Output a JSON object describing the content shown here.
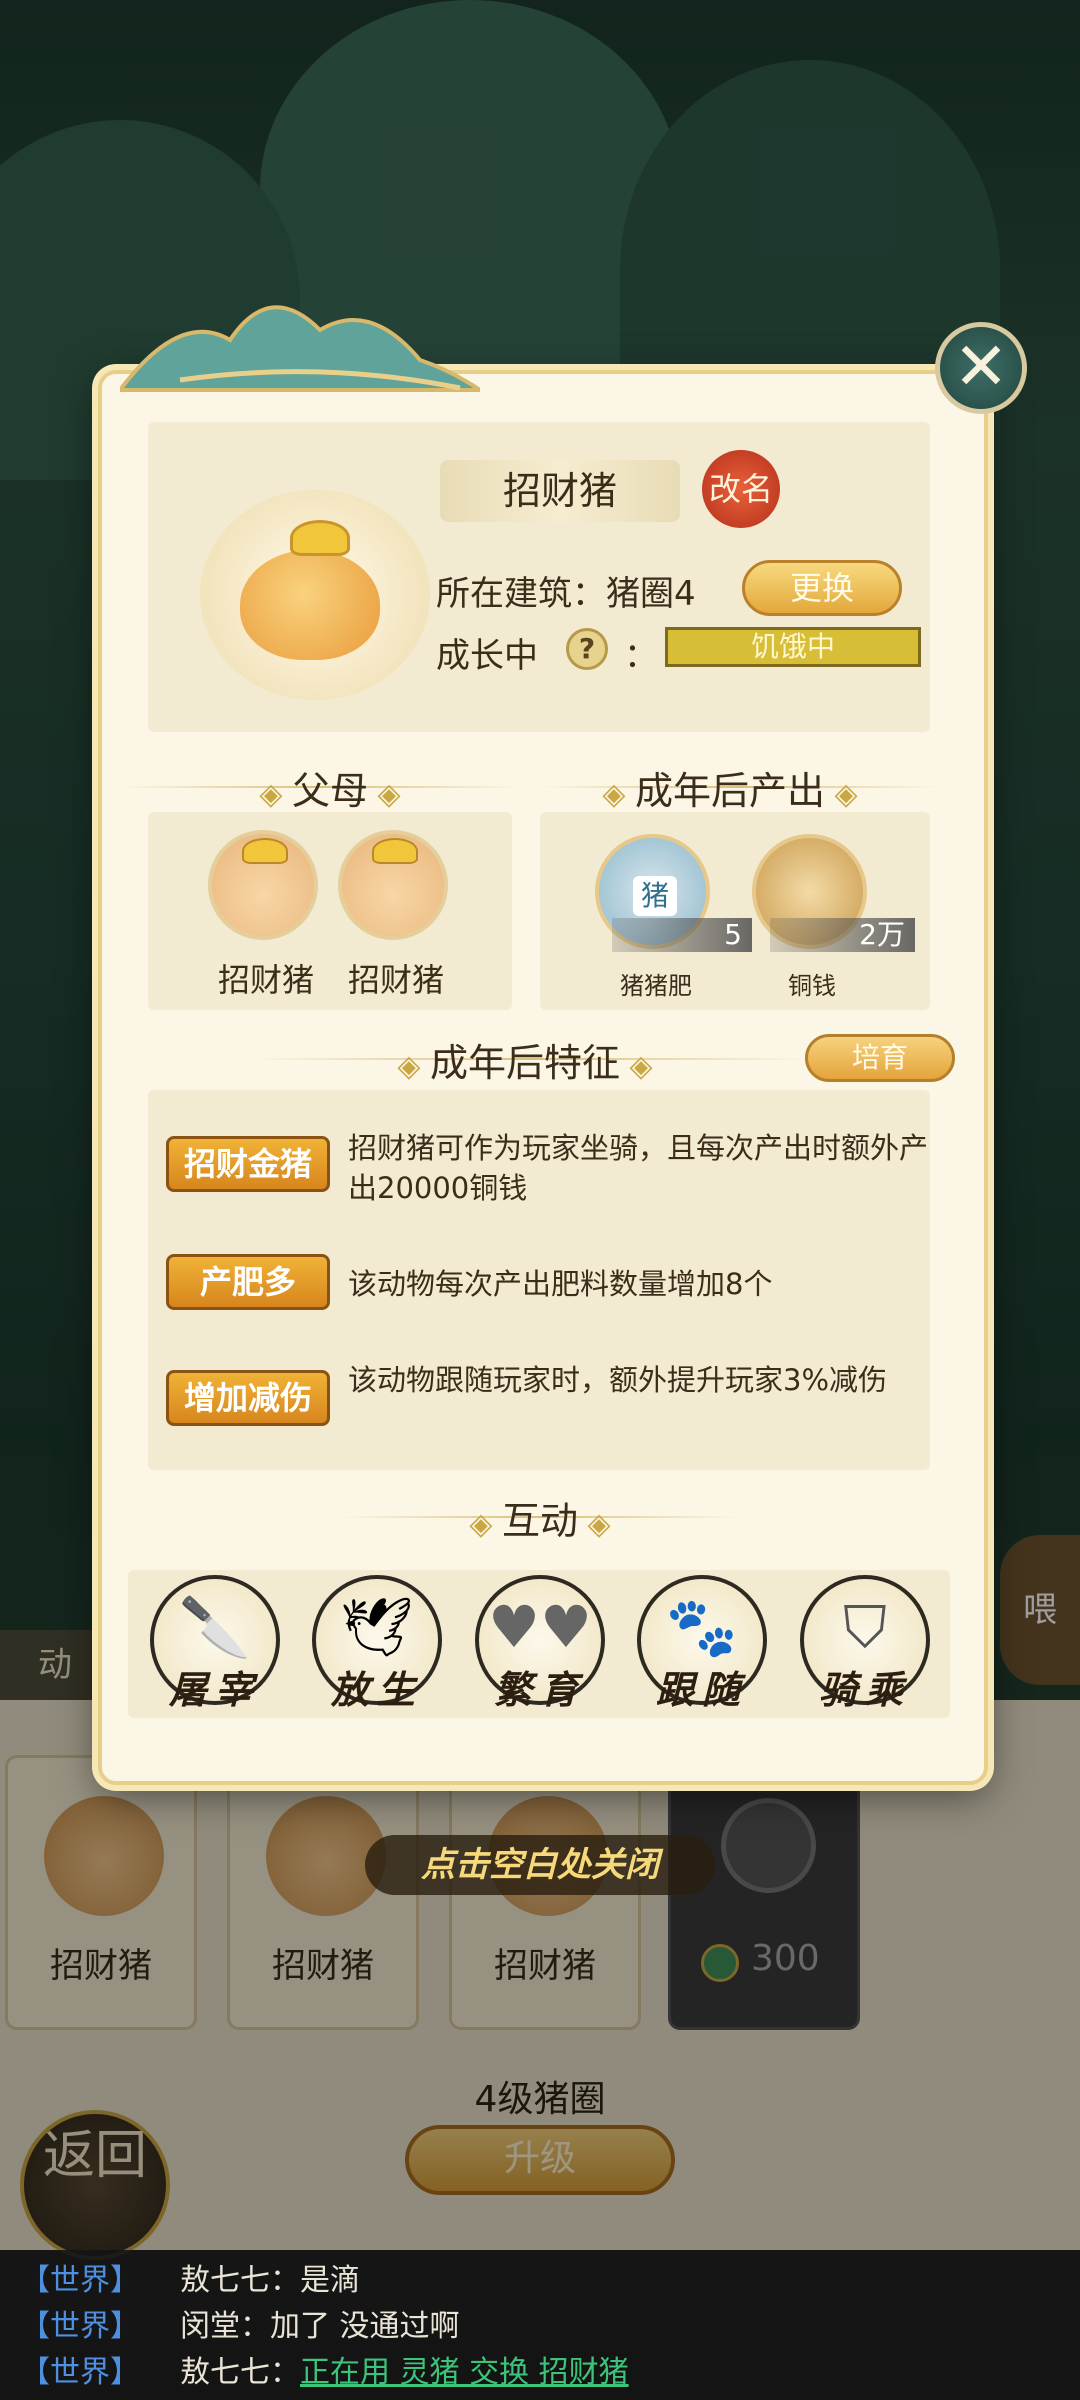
{
  "modal": {
    "pet_name": "招财猪",
    "rename_label": "改名",
    "building_label": "所在建筑：",
    "building_value": "猪圈4",
    "change_label": "更换",
    "growth_label": "成长中",
    "question_mark": "?",
    "colon": "：",
    "status": "饥饿中",
    "close_icon": "✕"
  },
  "parents": {
    "heading": "父母",
    "items": [
      {
        "name": "招财猪"
      },
      {
        "name": "招财猪"
      }
    ]
  },
  "outputs": {
    "heading": "成年后产出",
    "items": [
      {
        "name": "猪猪肥",
        "count": "5",
        "icon_text": "猪"
      },
      {
        "name": "铜钱",
        "count": "2万"
      }
    ]
  },
  "traits": {
    "heading": "成年后特征",
    "nurture_label": "培育",
    "items": [
      {
        "tag": "招财金猪",
        "desc": "招财猪可作为玩家坐骑，且每次产出时额外产出20000铜钱"
      },
      {
        "tag": "产肥多",
        "desc": "该动物每次产出肥料数量增加8个"
      },
      {
        "tag": "增加减伤",
        "desc": "该动物跟随玩家时，额外提升玩家3%减伤"
      }
    ]
  },
  "interact": {
    "heading": "互动",
    "actions": [
      {
        "label": "屠宰",
        "icon": "cleaver-icon"
      },
      {
        "label": "放生",
        "icon": "bird-icon"
      },
      {
        "label": "繁育",
        "icon": "hearts-icon"
      },
      {
        "label": "跟随",
        "icon": "paw-icon"
      },
      {
        "label": "骑乘",
        "icon": "saddle-icon"
      }
    ]
  },
  "background": {
    "hint": "点击空白处关闭",
    "pen_cards": [
      {
        "name": "招财猪"
      },
      {
        "name": "招财猪"
      },
      {
        "name": "招财猪"
      }
    ],
    "locked_cost": "300",
    "pen_title": "4级猪圈",
    "upgrade_label": "升级",
    "back_label": "返回",
    "side_label": "动",
    "feed_label": "喂"
  },
  "chat": [
    {
      "channel": "【世界】",
      "text": "敖七七：是滴"
    },
    {
      "channel": "【世界】",
      "text": "闵堂：加了   没通过啊"
    },
    {
      "channel": "【世界】",
      "speaker": "敖七七：",
      "link": "正在用 灵猪 交换 招财猪"
    }
  ],
  "colors": {
    "accent_gold": "#e4a43c",
    "trait_orange": "#d7861d",
    "status_yellow": "#d8bd36",
    "chat_channel_blue": "#4f8fe0",
    "chat_link_green": "#3cc47a"
  }
}
